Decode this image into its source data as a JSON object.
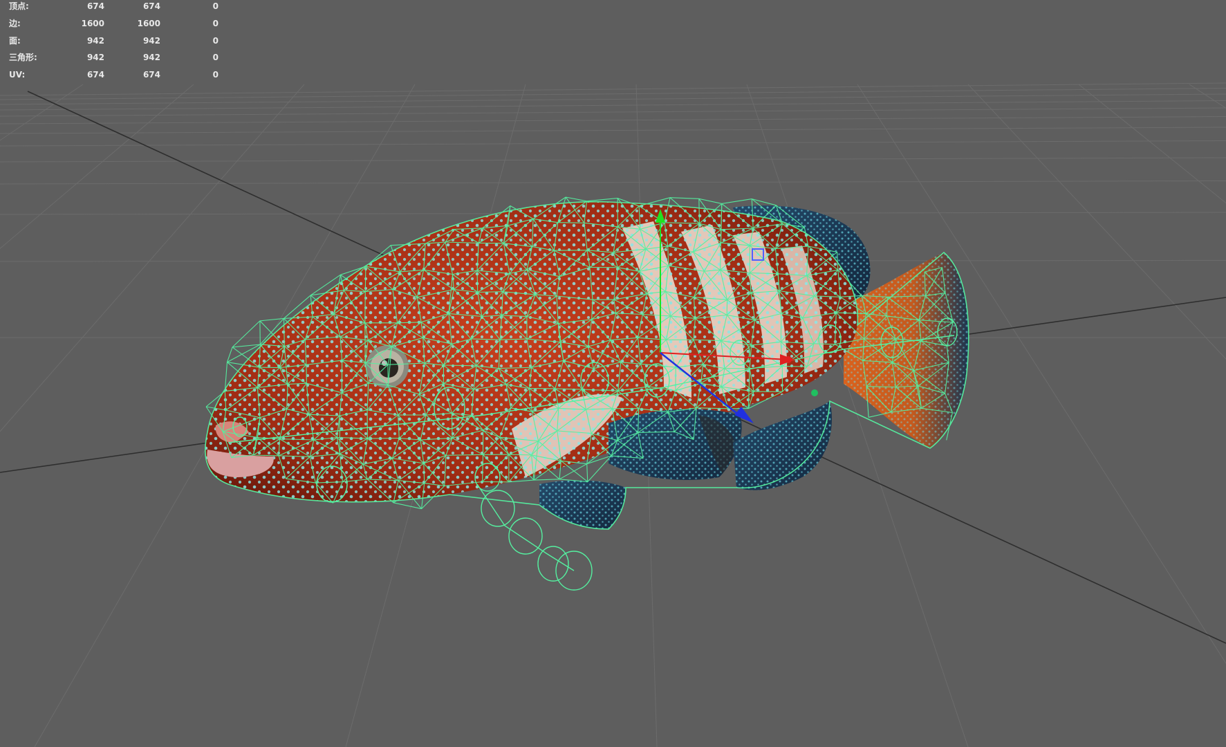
{
  "poly_count_hud": {
    "rows": [
      {
        "label": "顶点:",
        "values": [
          "674",
          "674",
          "0"
        ]
      },
      {
        "label": "边:",
        "values": [
          "1600",
          "1600",
          "0"
        ]
      },
      {
        "label": "面:",
        "values": [
          "942",
          "942",
          "0"
        ]
      },
      {
        "label": "三角形:",
        "values": [
          "942",
          "942",
          "0"
        ]
      },
      {
        "label": "UV:",
        "values": [
          "674",
          "674",
          "0"
        ]
      }
    ]
  },
  "colors": {
    "viewport_bg": "#5e5e5e",
    "grid_line": "#6c6c6c",
    "grid_axis": "#2e2e2e",
    "wireframe": "#55f0a0",
    "fish_body": "#b8321a",
    "fish_fins": "#1f3e5a",
    "spots": "#7fe6e0",
    "stripes": "#e8d8cc",
    "gizmo_x": "#e02020",
    "gizmo_y": "#20e020",
    "gizmo_z": "#2030e0"
  },
  "scene": {
    "object": "fish-mesh",
    "display_mode": "textured-wireframe"
  }
}
